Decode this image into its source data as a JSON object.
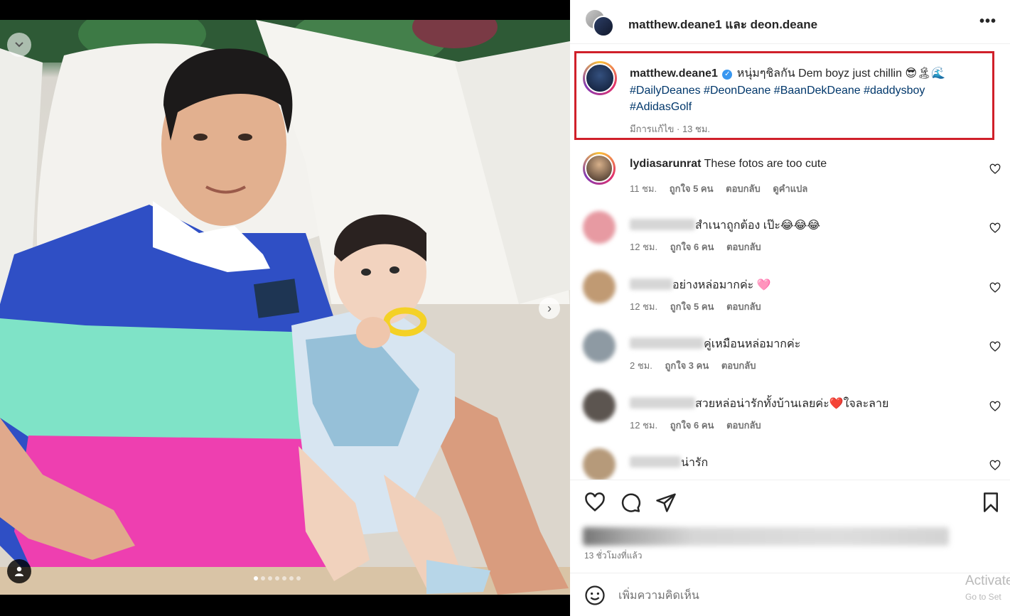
{
  "header": {
    "title": "matthew.deane1 และ deon.deane",
    "more_label": "•••"
  },
  "caption": {
    "username": "matthew.deane1",
    "text": "หนุ่มๆชิลกัน Dem boyz just chillin 😎🏝🌊",
    "hashtags": "#DailyDeanes #DeonDeane #BaanDekDeane #daddysboy #AdidasGolf",
    "meta": "มีการแก้ไข · 13 ชม."
  },
  "comments": [
    {
      "username": "lydiasarunrat",
      "text": "These fotos are too cute",
      "time": "11 ชม.",
      "likes": "ถูกใจ 5 คน",
      "reply": "ตอบกลับ",
      "translate": "ดูคำแปล"
    },
    {
      "username": "",
      "text": "สำเนาถูกต้อง เป๊ะ😂😂😂",
      "time": "12 ชม.",
      "likes": "ถูกใจ 6 คน",
      "reply": "ตอบกลับ"
    },
    {
      "username": "",
      "text": "อย่างหล่อมากค่ะ 🩷",
      "time": "12 ชม.",
      "likes": "ถูกใจ 5 คน",
      "reply": "ตอบกลับ"
    },
    {
      "username": "",
      "text": "คู่เหมือนหล่อมากค่ะ",
      "time": "2 ชม.",
      "likes": "ถูกใจ 3 คน",
      "reply": "ตอบกลับ"
    },
    {
      "username": "",
      "text": "สวยหล่อน่ารักทั้งบ้านเลยค่ะ❤️ใจละลาย",
      "time": "12 ชม.",
      "likes": "ถูกใจ 6 คน",
      "reply": "ตอบกลับ"
    },
    {
      "username": "",
      "text": "น่ารัก",
      "time": "",
      "likes": "",
      "reply": ""
    }
  ],
  "post": {
    "time": "13 ชั่วโมงที่แล้ว"
  },
  "add_comment": {
    "placeholder": "เพิ่มความคิดเห็น"
  },
  "watermark": {
    "line1": "Activate",
    "line2": "Go to Set"
  },
  "carousel": {
    "slide_count": 7,
    "active_index": 0
  },
  "colors": {
    "highlight_border": "#d0202a",
    "hashtag": "#00376b",
    "verified": "#3897f0"
  }
}
